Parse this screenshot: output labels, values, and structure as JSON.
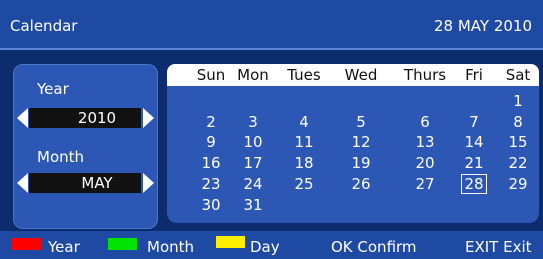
{
  "header": {
    "title": "Calendar",
    "date": "28 MAY 2010"
  },
  "sidebar": {
    "year_label": "Year",
    "year_value": "2010",
    "month_label": "Month",
    "month_value": "MAY"
  },
  "calendar": {
    "weekdays": [
      "Sun",
      "Mon",
      "Tues",
      "Wed",
      "Thurs",
      "Fri",
      "Sat"
    ],
    "weeks": [
      [
        "",
        "",
        "",
        "",
        "",
        "",
        "1"
      ],
      [
        "2",
        "3",
        "4",
        "5",
        "6",
        "7",
        "8"
      ],
      [
        "9",
        "10",
        "11",
        "12",
        "13",
        "14",
        "15"
      ],
      [
        "16",
        "17",
        "18",
        "19",
        "20",
        "21",
        "22"
      ],
      [
        "23",
        "24",
        "25",
        "26",
        "27",
        "28",
        "29"
      ],
      [
        "30",
        "31",
        "",
        "",
        "",
        "",
        ""
      ]
    ],
    "selected_day": "28"
  },
  "footer": {
    "red_label": "Year",
    "green_label": "Month",
    "yellow_label": "Day",
    "ok_label": "OK Confirm",
    "exit_label": "EXIT Exit"
  },
  "colors": {
    "red_key": "#ff0000",
    "green_key": "#00e200",
    "yellow_key": "#ffee00"
  }
}
